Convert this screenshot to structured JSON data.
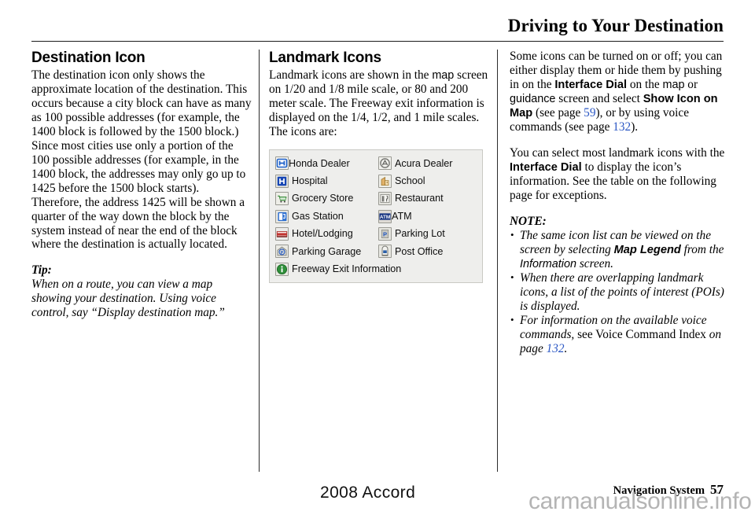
{
  "header": {
    "title": "Driving to Your Destination"
  },
  "left_column": {
    "heading": "Destination Icon",
    "paragraph": "The destination icon only shows the approximate location of the destination. This occurs because a city block can have as many as 100 possible addresses (for example, the 1400 block is followed by the 1500 block.) Since most cities use only a portion of the 100 possible addresses (for example, in the 1400 block, the addresses may only go up to 1425 before the 1500 block starts). Therefore, the address 1425 will be shown a quarter of the way down the block by the system instead of near the end of the block where the destination is actually located.",
    "tip_label": "Tip:",
    "tip_text": "When on a route, you can view a map showing your destination. Using voice control, say “Display destination map.”"
  },
  "middle_column": {
    "heading": "Landmark Icons",
    "intro_part1": "Landmark icons are shown in the ",
    "intro_ui_map": "map",
    "intro_part2": " screen on 1/20 and 1/8 mile scale, or 80 and 200 meter scale. The Freeway exit information is displayed on the 1/4, 1/2, and 1 mile scales. The icons are:",
    "icon_table": {
      "rows": [
        [
          {
            "icon": "honda-dealer-icon",
            "label": "Honda Dealer"
          },
          {
            "icon": "acura-dealer-icon",
            "label": "Acura Dealer"
          }
        ],
        [
          {
            "icon": "hospital-icon",
            "label": "Hospital"
          },
          {
            "icon": "school-icon",
            "label": "School"
          }
        ],
        [
          {
            "icon": "grocery-store-icon",
            "label": "Grocery Store"
          },
          {
            "icon": "restaurant-icon",
            "label": "Restaurant"
          }
        ],
        [
          {
            "icon": "gas-station-icon",
            "label": "Gas Station"
          },
          {
            "icon": "atm-icon",
            "label": "ATM"
          }
        ],
        [
          {
            "icon": "hotel-lodging-icon",
            "label": "Hotel/Lodging"
          },
          {
            "icon": "parking-lot-icon",
            "label": "Parking Lot"
          }
        ],
        [
          {
            "icon": "parking-garage-icon",
            "label": "Parking Garage"
          },
          {
            "icon": "post-office-icon",
            "label": "Post Office"
          }
        ],
        [
          {
            "icon": "freeway-exit-information-icon",
            "label": "Freeway Exit Information"
          }
        ]
      ]
    }
  },
  "right_column": {
    "para1": {
      "t1": "Some icons can be turned on or off; you can either display them or hide them by pushing in on the ",
      "b1": "Interface Dial",
      "t2": " on the ",
      "u1": "map",
      "t3": " or ",
      "u2": "guidance",
      "t4": " screen and select ",
      "b2": "Show Icon on Map",
      "t5": " (see page ",
      "link1": "59",
      "t6": "), or by using voice commands (see page ",
      "link2": "132",
      "t7": ")."
    },
    "para2": {
      "t1": "You can select most landmark icons with the ",
      "b1": "Interface Dial",
      "t2": " to display the icon’s information. See the table on the following page for exceptions."
    },
    "note_label": "NOTE:",
    "notes": [
      {
        "t1": "The same icon list can be viewed on the screen by selecting ",
        "b1": "Map Legend",
        "t2": " from the ",
        "u1": "Information",
        "t3": " screen."
      },
      {
        "t1": "When there are overlapping landmark icons, a list of the points of interest (POIs) is displayed."
      },
      {
        "t1": "For information on the available voice commands,",
        "t2": " see Voice Command Index ",
        "t3": "on page ",
        "link1": "132",
        "t4": "."
      }
    ]
  },
  "footer": {
    "model": "2008  Accord",
    "section": "Navigation System",
    "page_number": "57",
    "watermark": "carmanualsonline.info"
  },
  "colors": {
    "link": "#2b57c4",
    "rule": "#1b1b1b",
    "table_bg": "#eeeeec",
    "table_border": "#c9c9c4",
    "honda_blue": "#1b5fc9",
    "hospital_blue": "#1746b4",
    "school_tan": "#d8a457",
    "grocery_green": "#3f8f3f",
    "gas_blue": "#2d6fd0",
    "hotel_red": "#c23430",
    "parking_blue": "#2056c0",
    "atm_navy": "#12307f",
    "post_blue": "#2b5fa8",
    "info_green": "#2f8f3a",
    "watermark": "#b4b4b4"
  }
}
